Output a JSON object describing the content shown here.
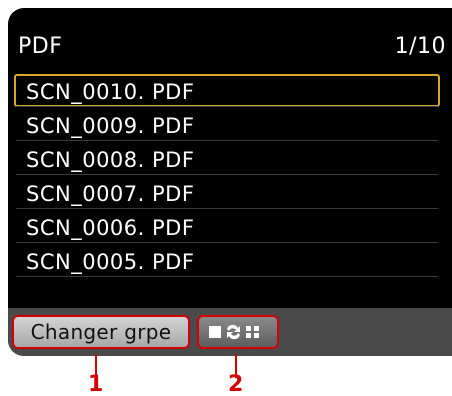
{
  "header": {
    "title": "PDF",
    "page_indicator": "1/10"
  },
  "files": [
    {
      "name": "SCN_0010. PDF",
      "selected": true
    },
    {
      "name": "SCN_0009. PDF",
      "selected": false
    },
    {
      "name": "SCN_0008. PDF",
      "selected": false
    },
    {
      "name": "SCN_0007. PDF",
      "selected": false
    },
    {
      "name": "SCN_0006. PDF",
      "selected": false
    },
    {
      "name": "SCN_0005. PDF",
      "selected": false
    }
  ],
  "bottom_bar": {
    "change_group_label": "Changer grpe",
    "view_toggle_icon": "single-view-toggle-grid-view-icon"
  },
  "callouts": {
    "first": "1",
    "second": "2"
  },
  "colors": {
    "screen_bg": "#000000",
    "selection": "#d4a82a",
    "callout": "#d40000"
  }
}
